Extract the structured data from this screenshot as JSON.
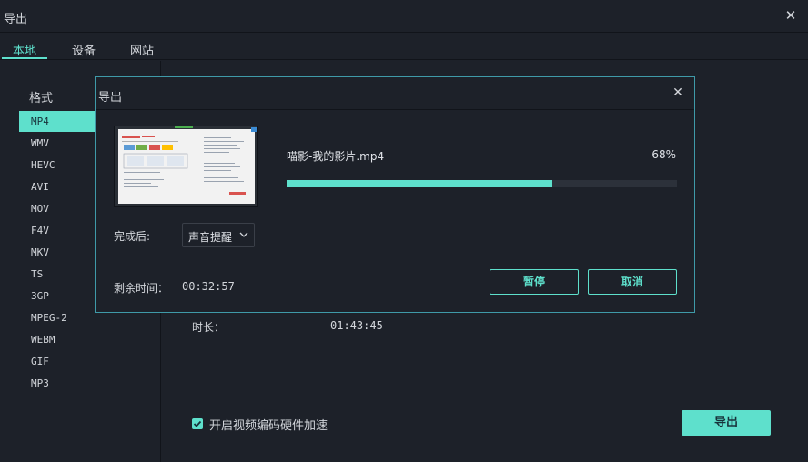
{
  "window": {
    "title": "导出",
    "close_icon": "close-icon"
  },
  "tabs": [
    {
      "label": "本地",
      "active": true
    },
    {
      "label": "设备",
      "active": false
    },
    {
      "label": "网站",
      "active": false
    }
  ],
  "formats": {
    "heading": "格式",
    "items": [
      "MP4",
      "WMV",
      "HEVC",
      "AVI",
      "MOV",
      "F4V",
      "MKV",
      "TS",
      "3GP",
      "MPEG-2",
      "WEBM",
      "GIF",
      "MP3"
    ],
    "selected": "MP4"
  },
  "details": {
    "duration_label": "时长：",
    "duration_value": "01:43:45"
  },
  "hardware_accel": {
    "label": "开启视频编码硬件加速",
    "checked": true
  },
  "export_button": "导出",
  "modal": {
    "title": "导出",
    "file_name": "喵影-我的影片.mp4",
    "progress": {
      "percent": 68,
      "label": "68%"
    },
    "after_label": "完成后:",
    "after_value": "声音提醒",
    "remaining_label": "剩余时间：",
    "remaining_value": "00:32:57",
    "pause_button": "暂停",
    "cancel_button": "取消"
  },
  "colors": {
    "accent": "#5ee0cc",
    "background": "#1d2129",
    "modal_border": "#3f9aa8",
    "track": "#2c313a"
  }
}
